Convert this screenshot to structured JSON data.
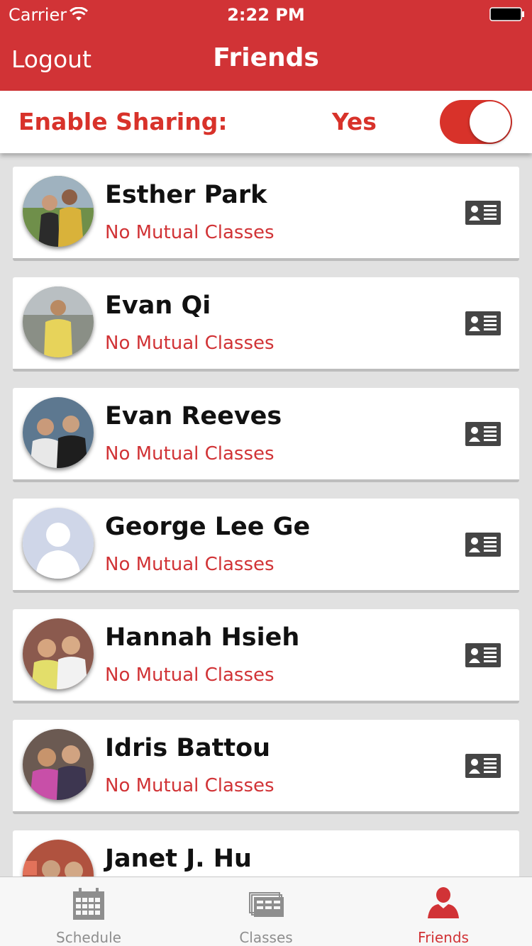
{
  "status_bar": {
    "carrier": "Carrier",
    "time": "2:22 PM"
  },
  "nav": {
    "left_button": "Logout",
    "title": "Friends"
  },
  "sharing": {
    "label": "Enable Sharing:",
    "value": "Yes",
    "toggle_on": true
  },
  "friends": [
    {
      "name": "Esther Park",
      "subtitle": "No Mutual Classes"
    },
    {
      "name": "Evan Qi",
      "subtitle": "No Mutual Classes"
    },
    {
      "name": "Evan Reeves",
      "subtitle": "No Mutual Classes"
    },
    {
      "name": "George Lee Ge",
      "subtitle": "No Mutual Classes"
    },
    {
      "name": "Hannah Hsieh",
      "subtitle": "No Mutual Classes"
    },
    {
      "name": "Idris Battou",
      "subtitle": "No Mutual Classes"
    },
    {
      "name": "Janet J. Hu",
      "subtitle": ""
    }
  ],
  "tabs": [
    {
      "label": "Schedule",
      "icon": "calendar-icon",
      "active": false
    },
    {
      "label": "Classes",
      "icon": "classes-icon",
      "active": false
    },
    {
      "label": "Friends",
      "icon": "person-icon",
      "active": true
    }
  ],
  "colors": {
    "brand_red": "#d13336",
    "accent_red": "#d8322a",
    "tab_inactive": "#8e8e8e"
  }
}
